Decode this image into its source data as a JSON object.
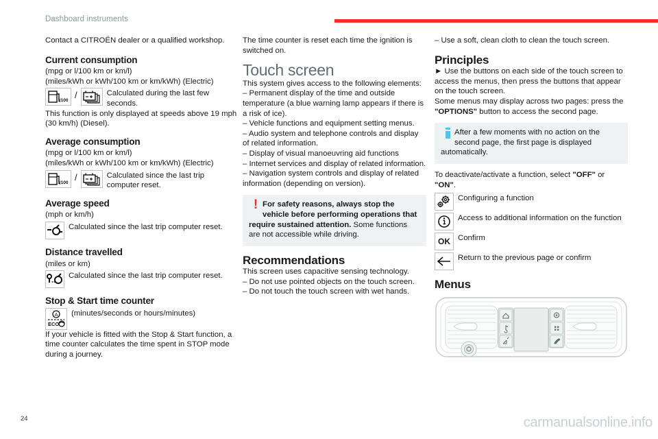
{
  "header": {
    "title": "Dashboard instruments",
    "rule_color": "#fa2a2a"
  },
  "footer": {
    "page_number": "24",
    "watermark": "carmanualsonline.info"
  },
  "colors": {
    "chapter_heading": "#5e7070",
    "accent_red": "#fa2a2a",
    "info_blue": "#4fc3e8",
    "admonition_bg": "#eef2f3"
  },
  "col1": {
    "intro": "Contact a CITROËN dealer or a qualified workshop.",
    "current_consumption": {
      "heading": "Current consumption",
      "units_line1": "(mpg or l/100 km or km/l)",
      "units_line2": "(miles/kWh or kWh/100 km or km/kWh) (Electric)",
      "icon_a": "fuel-pump-icon",
      "icon_a_label": "l/100",
      "separator": "/",
      "icon_b": "battery-stack-icon",
      "icon_text": "Calculated during the last few seconds.",
      "note": "This function is only displayed at speeds above 19 mph (30 km/h) (Diesel)."
    },
    "average_consumption": {
      "heading": "Average consumption",
      "units_line1": "(mpg or l/100 km or km/l)",
      "units_line2": "(miles/kWh or kWh/100 km or km/kWh) (Electric)",
      "icon_a": "fuel-pump-icon",
      "icon_a_label": "l/100",
      "separator": "/",
      "icon_b": "battery-stack-icon",
      "icon_text": "Calculated since the last trip computer reset."
    },
    "average_speed": {
      "heading": "Average speed",
      "units_line1": "(mph or km/h)",
      "icon": "average-speed-gauge-icon",
      "icon_text": "Calculated since the last trip computer reset."
    },
    "distance_travelled": {
      "heading": "Distance travelled",
      "units_line1": "(miles or km)",
      "icon": "distance-travelled-icon",
      "icon_text": "Calculated since the last trip computer reset."
    },
    "stop_start": {
      "heading": "Stop & Start time counter",
      "icon": "stop-start-eco-icon",
      "icon_label_top": "A",
      "icon_label_bottom": "ECO",
      "icon_text": "(minutes/seconds or hours/minutes)",
      "body": "If your vehicle is fitted with the Stop & Start function, a time counter calculates the time spent in STOP mode during a journey."
    }
  },
  "col2": {
    "intro": "The time counter is reset each time the ignition is switched on.",
    "touch_screen": {
      "heading": "Touch screen",
      "lead": "This system gives access to the following elements:",
      "bullets": [
        "–  Permanent display of the time and outside temperature (a blue warning lamp appears if there is a risk of ice).",
        "–  Vehicle functions and equipment setting menus.",
        "–  Audio system and telephone controls and display of related information.",
        "–  Display of visual manoeuvring aid functions",
        "–  Internet services and display of related information.",
        "–  Navigation system controls and display of related information (depending on version)."
      ]
    },
    "warning": {
      "icon": "warning-exclamation-icon",
      "bold_text": "For safety reasons, always stop the vehicle before performing operations that require sustained attention.",
      "normal_text": "Some functions are not accessible while driving."
    },
    "recommendations": {
      "heading": "Recommendations",
      "lead": "This screen uses capacitive sensing technology.",
      "bullets": [
        "–  Do not use pointed objects on the touch screen.",
        "–  Do not touch the touch screen with wet hands."
      ]
    }
  },
  "col3": {
    "intro": "–  Use a soft, clean cloth to clean the touch screen.",
    "principles": {
      "heading": "Principles",
      "arrow": "►",
      "body1": "Use the buttons on each side of the touch screen to access the menus, then press the buttons that appear on the touch screen.",
      "body2_pre": "Some menus may display across two pages: press the ",
      "body2_bold": "\"OPTIONS\"",
      "body2_post": " button to access the second page."
    },
    "info": {
      "icon": "info-bar-icon",
      "text": "After a few moments with no action on the second page, the first page is displayed automatically."
    },
    "toggle_note_pre": "To deactivate/activate a function, select ",
    "toggle_off": "\"OFF\"",
    "toggle_mid": " or ",
    "toggle_on": "\"ON\"",
    "toggle_post": ".",
    "legend": [
      {
        "icon": "gear-config-icon",
        "glyph": "",
        "label": "Configuring a function"
      },
      {
        "icon": "circle-info-icon",
        "glyph": "",
        "label": "Access to additional information on the function"
      },
      {
        "icon": "ok-confirm-icon",
        "glyph": "OK",
        "label": "Confirm"
      },
      {
        "icon": "back-arrow-icon",
        "glyph": "←",
        "label": "Return to the previous page or confirm"
      }
    ],
    "menus": {
      "heading": "Menus",
      "illustration": "dashboard-console-illustration",
      "left_buttons": [
        "home-icon",
        "music-note-icon",
        "radio-icon"
      ],
      "right_buttons": [
        "settings-gear-icon",
        "apps-grid-icon",
        "phone-icon"
      ],
      "knob": "power-volume-knob-icon",
      "screen": "touch-screen-display"
    }
  }
}
